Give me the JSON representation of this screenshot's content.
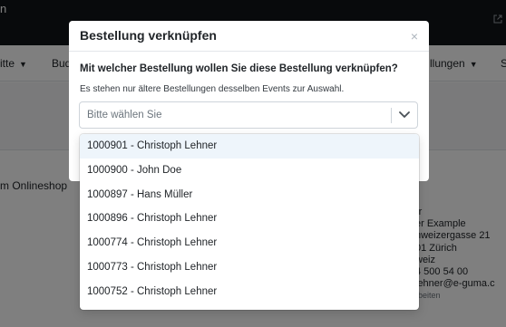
{
  "background": {
    "title_fragment": "n",
    "nav_items": [
      {
        "label": "itte"
      },
      {
        "label": "Bud"
      },
      {
        "label": "llungen"
      },
      {
        "label": "S"
      }
    ],
    "shop_label": "m Onlineshop",
    "address_lines": [
      "rr",
      "er Example",
      "nweizergasse 21",
      "01 Zürich",
      "weiz",
      "4 500 54 00",
      "lehner@e-guma.c"
    ],
    "edit_label": "rbeiten"
  },
  "modal": {
    "title": "Bestellung verknüpfen",
    "close_label": "×",
    "question": "Mit welcher Bestellung wollen Sie diese Bestellung verknüpfen?",
    "hint": "Es stehen nur ältere Bestellungen desselben Events zur Auswahl.",
    "select": {
      "placeholder": "Bitte wählen Sie",
      "arrow_icon": "chevron-down-icon"
    }
  },
  "dropdown": {
    "options": [
      {
        "label": "1000901 - Christoph Lehner"
      },
      {
        "label": "1000900 - John Doe"
      },
      {
        "label": "1000897 - Hans Müller"
      },
      {
        "label": "1000896 - Christoph Lehner"
      },
      {
        "label": "1000774 - Christoph Lehner"
      },
      {
        "label": "1000773 - Christoph Lehner"
      },
      {
        "label": "1000752 - Christoph Lehner"
      }
    ],
    "highlighted_index": 0
  },
  "colors": {
    "topbar": "#111418",
    "highlight": "#eef5fb",
    "backdrop": "rgba(0,0,0,0.5)"
  }
}
